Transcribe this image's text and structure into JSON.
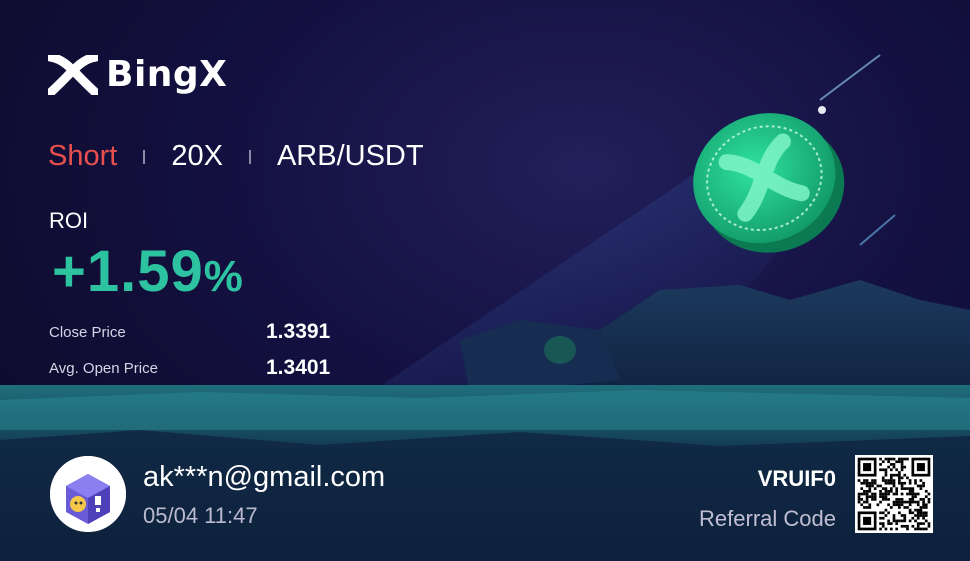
{
  "brand": {
    "name": "BingX"
  },
  "position": {
    "side": "Short",
    "leverage": "20X",
    "pair": "ARB/USDT"
  },
  "roi": {
    "label": "ROI",
    "value": "+1.59",
    "unit": "%"
  },
  "prices": [
    {
      "label": "Close Price",
      "value": "1.3391"
    },
    {
      "label": "Avg. Open Price",
      "value": "1.3401"
    }
  ],
  "user": {
    "email": "ak***n@gmail.com",
    "time": "05/04 11:47"
  },
  "referral": {
    "code": "VRUIF0",
    "label": "Referral Code"
  },
  "colors": {
    "short": "#e8504e",
    "roi": "#2ec3a0",
    "coin": "#1fbf86"
  }
}
